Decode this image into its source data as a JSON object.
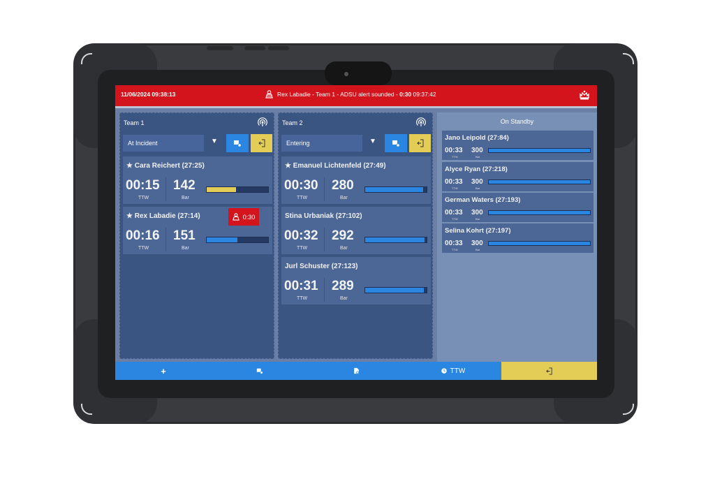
{
  "alert": {
    "datetime": "11/06/2024 09:38:13",
    "message_prefix": "Rex Labadie - Team 1 - ADSU alert sounded - ",
    "alert_timer": "0:30",
    "alert_time": "09:37:42"
  },
  "teams": [
    {
      "name": "Team 1",
      "status": "At Incident",
      "members": [
        {
          "name": "★ Cara Reichert (27:25)",
          "ttw": "00:15",
          "ttw_label": "TTW",
          "bar": "142",
          "bar_label": "Bar",
          "gauge_fill": 0.48,
          "gauge_state": "warning"
        },
        {
          "name": "★ Rex Labadie (27:14)",
          "ttw": "00:16",
          "ttw_label": "TTW",
          "bar": "151",
          "bar_label": "Bar",
          "gauge_fill": 0.5,
          "gauge_state": "normal",
          "alarm": "0:30"
        }
      ]
    },
    {
      "name": "Team 2",
      "status": "Entering",
      "members": [
        {
          "name": "★ Emanuel Lichtenfeld (27:49)",
          "ttw": "00:30",
          "ttw_label": "TTW",
          "bar": "280",
          "bar_label": "Bar",
          "gauge_fill": 0.94,
          "gauge_state": "normal"
        },
        {
          "name": "Stina Urbaniak (27:102)",
          "ttw": "00:32",
          "ttw_label": "TTW",
          "bar": "292",
          "bar_label": "Bar",
          "gauge_fill": 0.97,
          "gauge_state": "normal"
        },
        {
          "name": "Jurl Schuster (27:123)",
          "ttw": "00:31",
          "ttw_label": "TTW",
          "bar": "289",
          "bar_label": "Bar",
          "gauge_fill": 0.96,
          "gauge_state": "normal"
        }
      ]
    }
  ],
  "standby": {
    "title": "On Standby",
    "members": [
      {
        "name": "Jano Leipold (27:84)",
        "ttw": "00:33",
        "ttw_label": "TTW",
        "bar": "300",
        "bar_label": "Bar"
      },
      {
        "name": "Alyce Ryan (27:218)",
        "ttw": "00:33",
        "ttw_label": "TTW",
        "bar": "300",
        "bar_label": "Bar"
      },
      {
        "name": "German Waters (27:193)",
        "ttw": "00:33",
        "ttw_label": "TTW",
        "bar": "300",
        "bar_label": "Bar"
      },
      {
        "name": "Selina Kohrt (27:197)",
        "ttw": "00:33",
        "ttw_label": "TTW",
        "bar": "300",
        "bar_label": "Bar"
      }
    ]
  },
  "bottombar": {
    "add_label": "+",
    "ttw_label": "TTW"
  },
  "colors": {
    "alert_red": "#d3141c",
    "accent_blue": "#2a86e0",
    "warning_yellow": "#e3cd57",
    "panel_navy": "#3a5581"
  },
  "icons": {
    "dropdown": "▼"
  }
}
